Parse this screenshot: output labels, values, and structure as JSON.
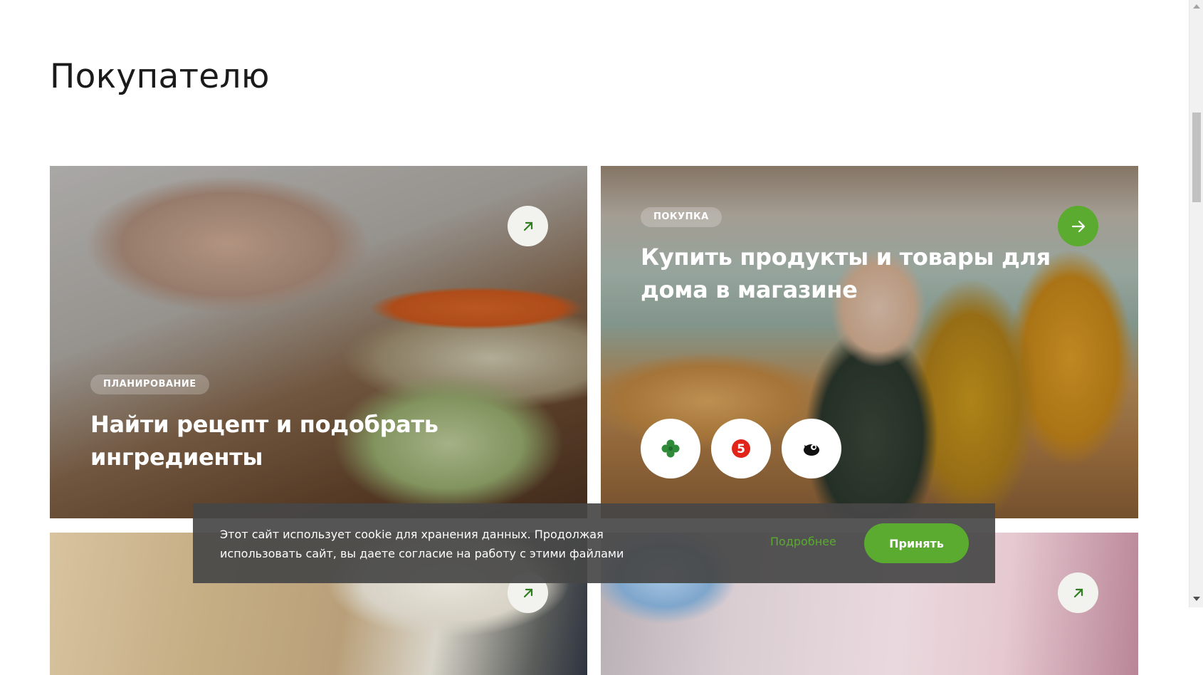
{
  "page": {
    "title": "Покупателю"
  },
  "cards": [
    {
      "tag": "ПЛАНИРОВАНИЕ",
      "title_line1": "Найти рецепт и подобрать",
      "title_line2": "ингредиенты",
      "arrow_icon": "arrow-up-right-icon"
    },
    {
      "tag": "ПОКУПКА",
      "title_line1": "Купить продукты и товары для",
      "title_line2": "дома в магазине",
      "arrow_icon": "arrow-right-icon",
      "stores": [
        "clover-logo-icon",
        "pyaterochka-logo-icon",
        "bird-logo-icon"
      ]
    },
    {
      "arrow_icon": "arrow-up-right-icon"
    },
    {
      "arrow_icon": "arrow-up-right-icon"
    }
  ],
  "cookie": {
    "text_line1": "Этот сайт использует cookie для хранения данных. Продолжая",
    "text_line2": "использовать сайт, вы даете согласие на работу с этими файлами",
    "more_label": "Подробнее",
    "accept_label": "Принять"
  },
  "colors": {
    "accent": "#5aab2f",
    "overlay": "#464646"
  }
}
